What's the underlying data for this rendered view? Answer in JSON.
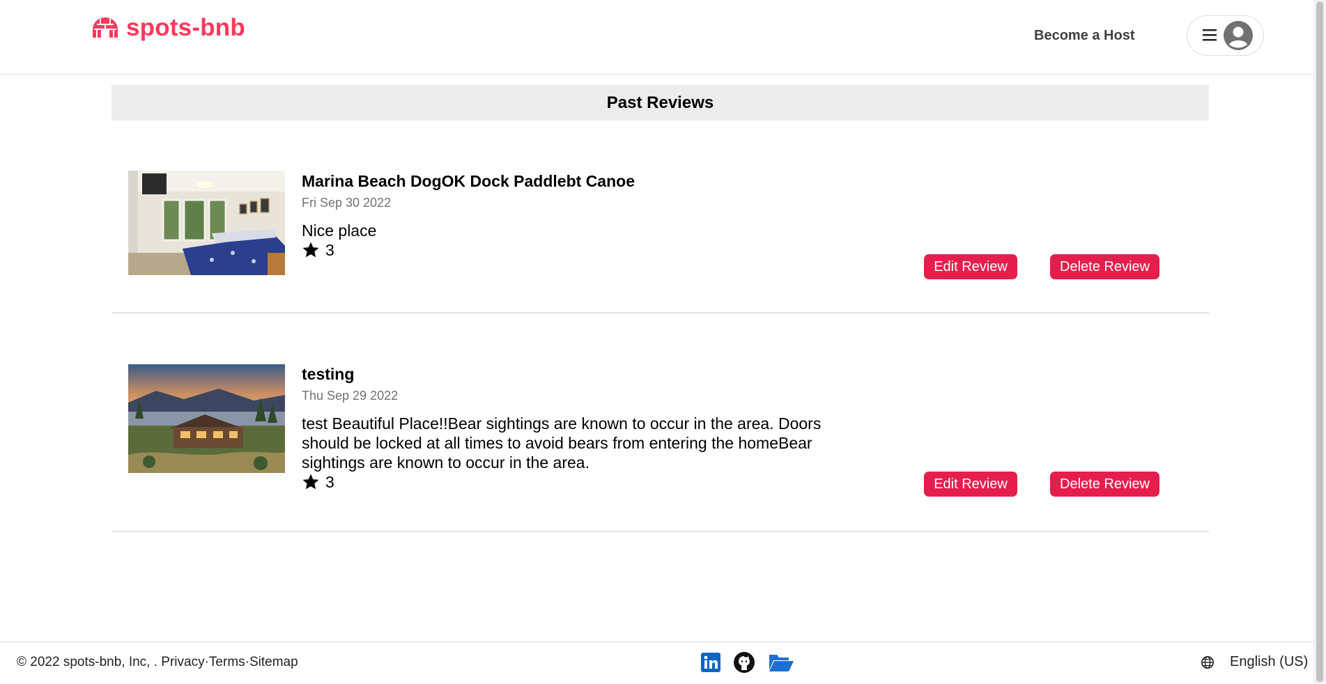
{
  "header": {
    "brand": "spots-bnb",
    "become_host": "Become a Host"
  },
  "page": {
    "title": "Past Reviews"
  },
  "reviews": [
    {
      "spot_name": "Marina Beach DogOK Dock Paddlebt Canoe",
      "date": "Fri Sep 30 2022",
      "text": "Nice place",
      "stars": "3",
      "image": "bedroom-photo",
      "edit_label": "Edit Review",
      "delete_label": "Delete Review"
    },
    {
      "spot_name": "testing",
      "date": "Thu Sep 29 2022",
      "text": "test Beautiful Place!!Bear sightings are known to occur in the area. Doors should be locked at all times to avoid bears from entering the homeBear sightings are known to occur in the area.",
      "stars": "3",
      "image": "lakehouse-photo",
      "edit_label": "Edit Review",
      "delete_label": "Delete Review"
    }
  ],
  "footer": {
    "copyright": "© 2022 spots-bnb, Inc, .",
    "privacy": "Privacy",
    "sep1": "·",
    "terms": "Terms",
    "sep2": "·",
    "sitemap": "Sitemap",
    "language": "English (US)",
    "icons": [
      "linkedin-icon",
      "github-icon",
      "folder-icon",
      "globe-icon"
    ]
  },
  "colors": {
    "brand": "#ff385c",
    "button": "#e61e4d",
    "title_bar": "#ececec"
  }
}
